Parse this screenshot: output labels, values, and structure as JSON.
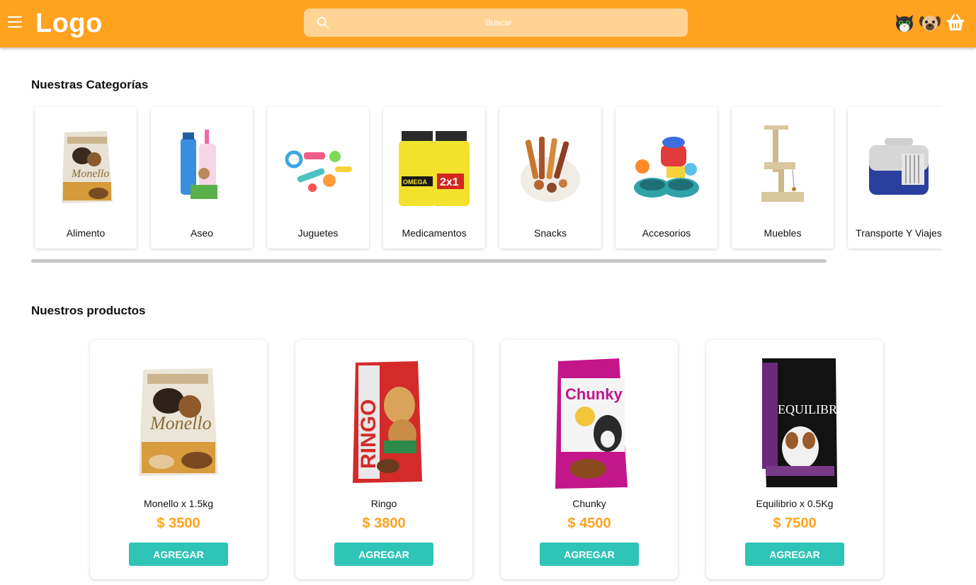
{
  "header": {
    "logo": "Logo",
    "search_placeholder": "Buscar",
    "bg_color": "#ffa21f",
    "icons": [
      "menu-icon",
      "cat-icon",
      "dog-icon",
      "basket-icon"
    ]
  },
  "categories": {
    "title": "Nuestras Categorías",
    "items": [
      {
        "label": "Alimento"
      },
      {
        "label": "Aseo"
      },
      {
        "label": "Juguetes"
      },
      {
        "label": "Medicamentos"
      },
      {
        "label": "Snacks"
      },
      {
        "label": "Accesorios"
      },
      {
        "label": "Muebles"
      },
      {
        "label": "Transporte Y Viajes"
      }
    ]
  },
  "products": {
    "title": "Nuestros productos",
    "button_label": "AGREGAR",
    "price_color": "#ffa21f",
    "button_color": "#2ec4b6",
    "items": [
      {
        "name": "Monello x 1.5kg",
        "price": "$ 3500"
      },
      {
        "name": "Ringo",
        "price": "$ 3800"
      },
      {
        "name": "Chunky",
        "price": "$ 4500"
      },
      {
        "name": "Equilibrio x 0.5Kg",
        "price": "$ 7500"
      }
    ]
  }
}
